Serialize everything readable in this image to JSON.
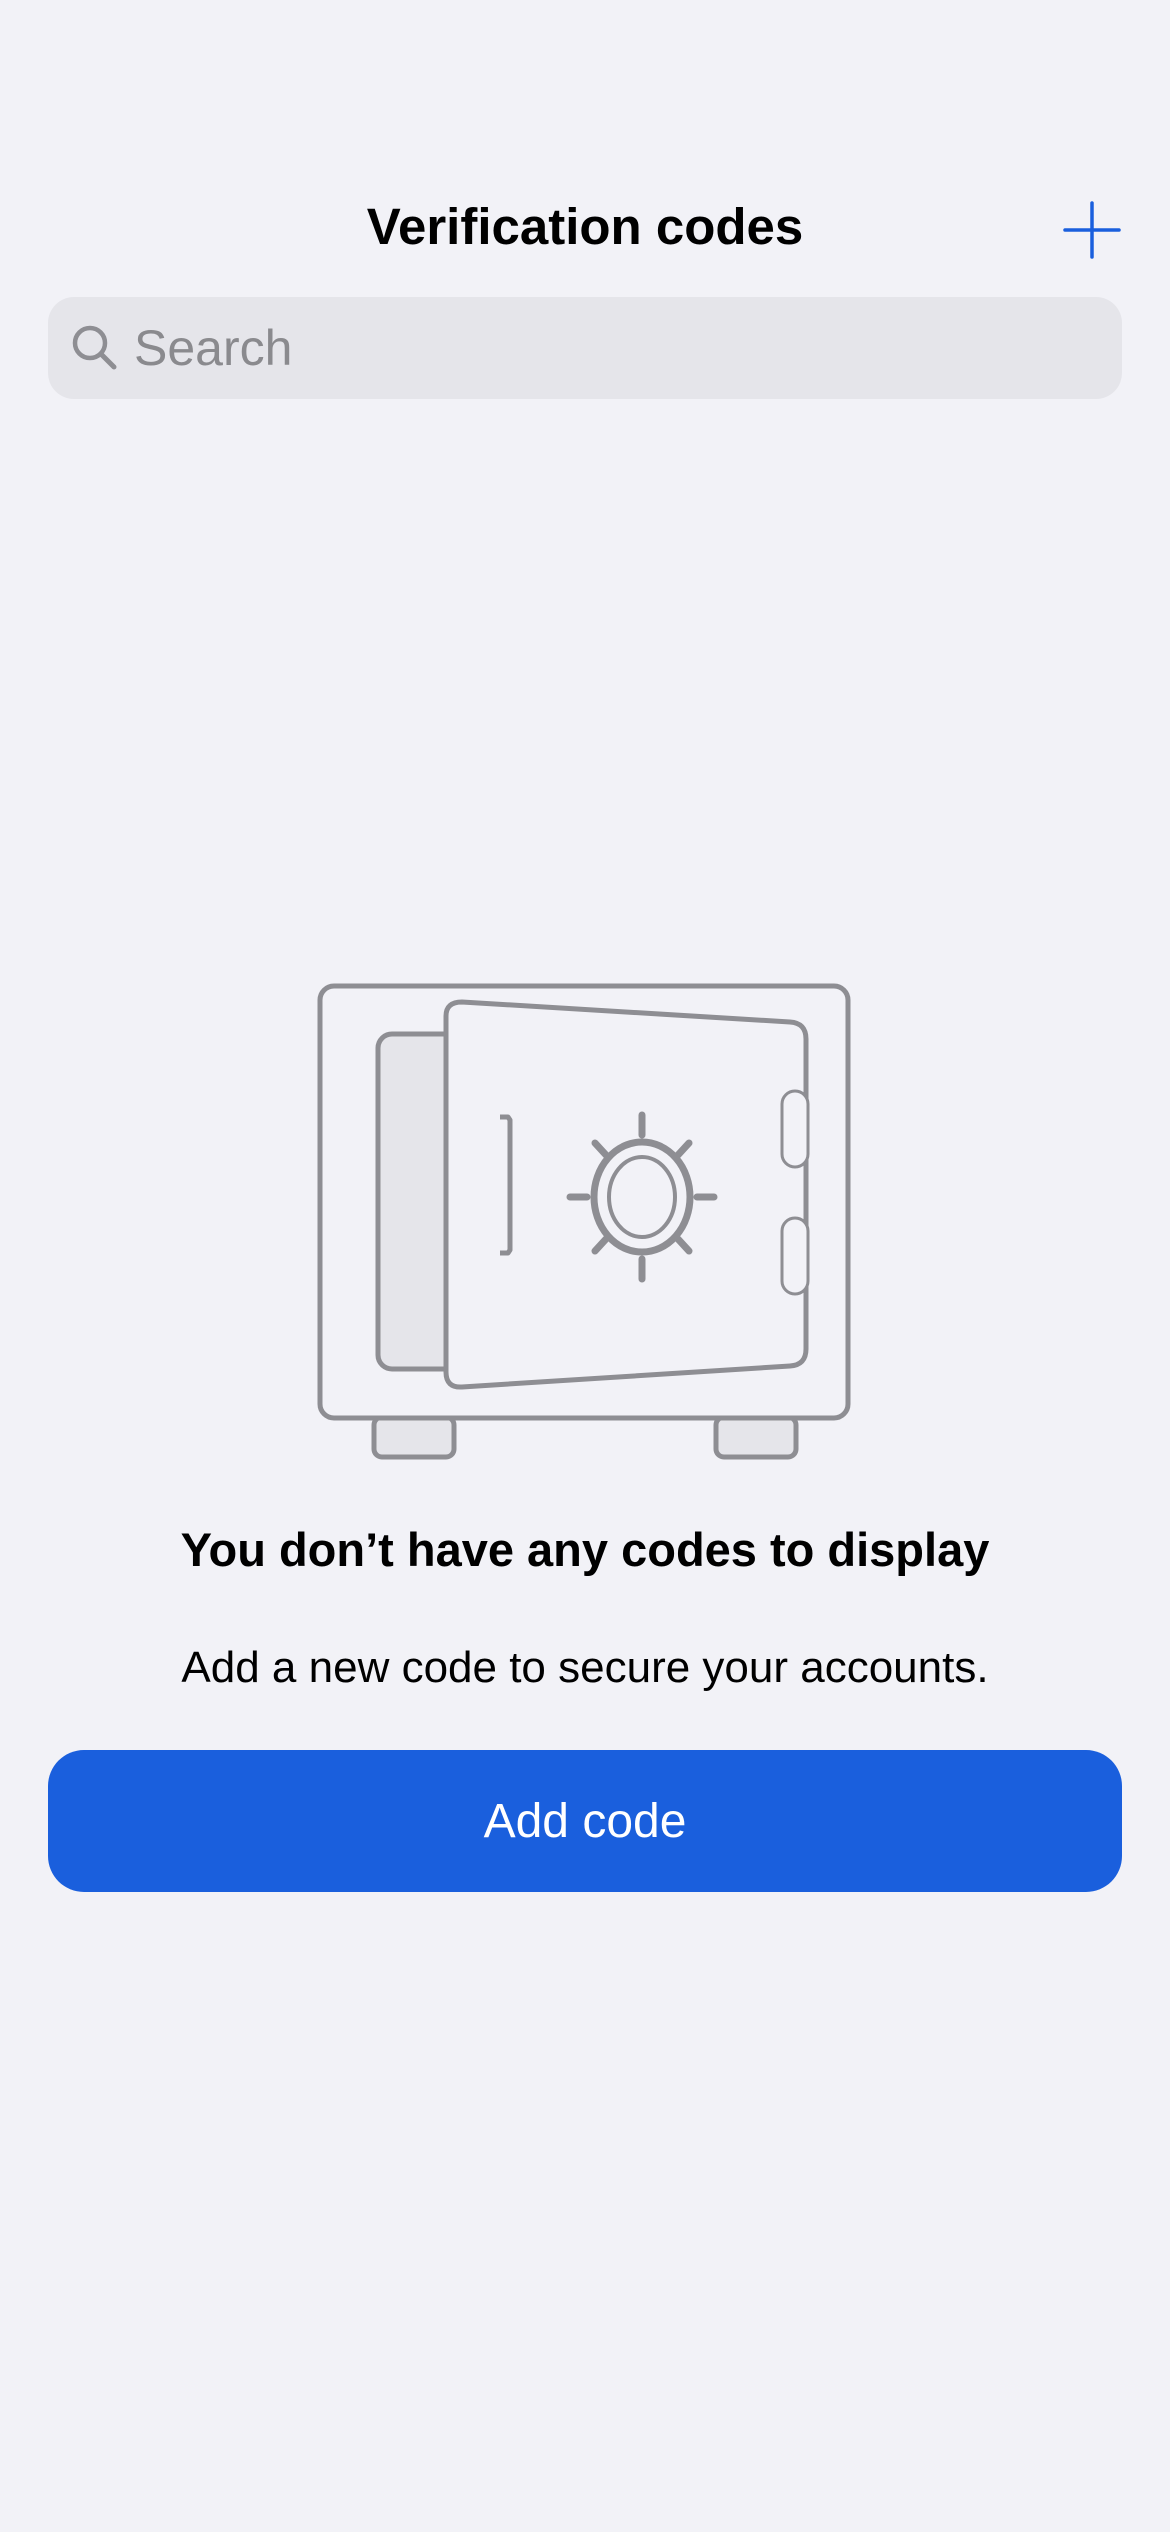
{
  "header": {
    "title": "Verification codes",
    "add_icon": "plus-icon"
  },
  "search": {
    "placeholder": "Search",
    "value": "",
    "icon": "magnifier-icon"
  },
  "empty_state": {
    "illustration": "safe-icon",
    "title": "You don’t have any codes to display",
    "subtitle": "Add a new code to secure your accounts.",
    "button_label": "Add code"
  },
  "colors": {
    "background": "#f2f2f7",
    "accent": "#1a5fdd",
    "search_bg": "#e5e5ea",
    "icon_gray": "#8e8e93"
  }
}
